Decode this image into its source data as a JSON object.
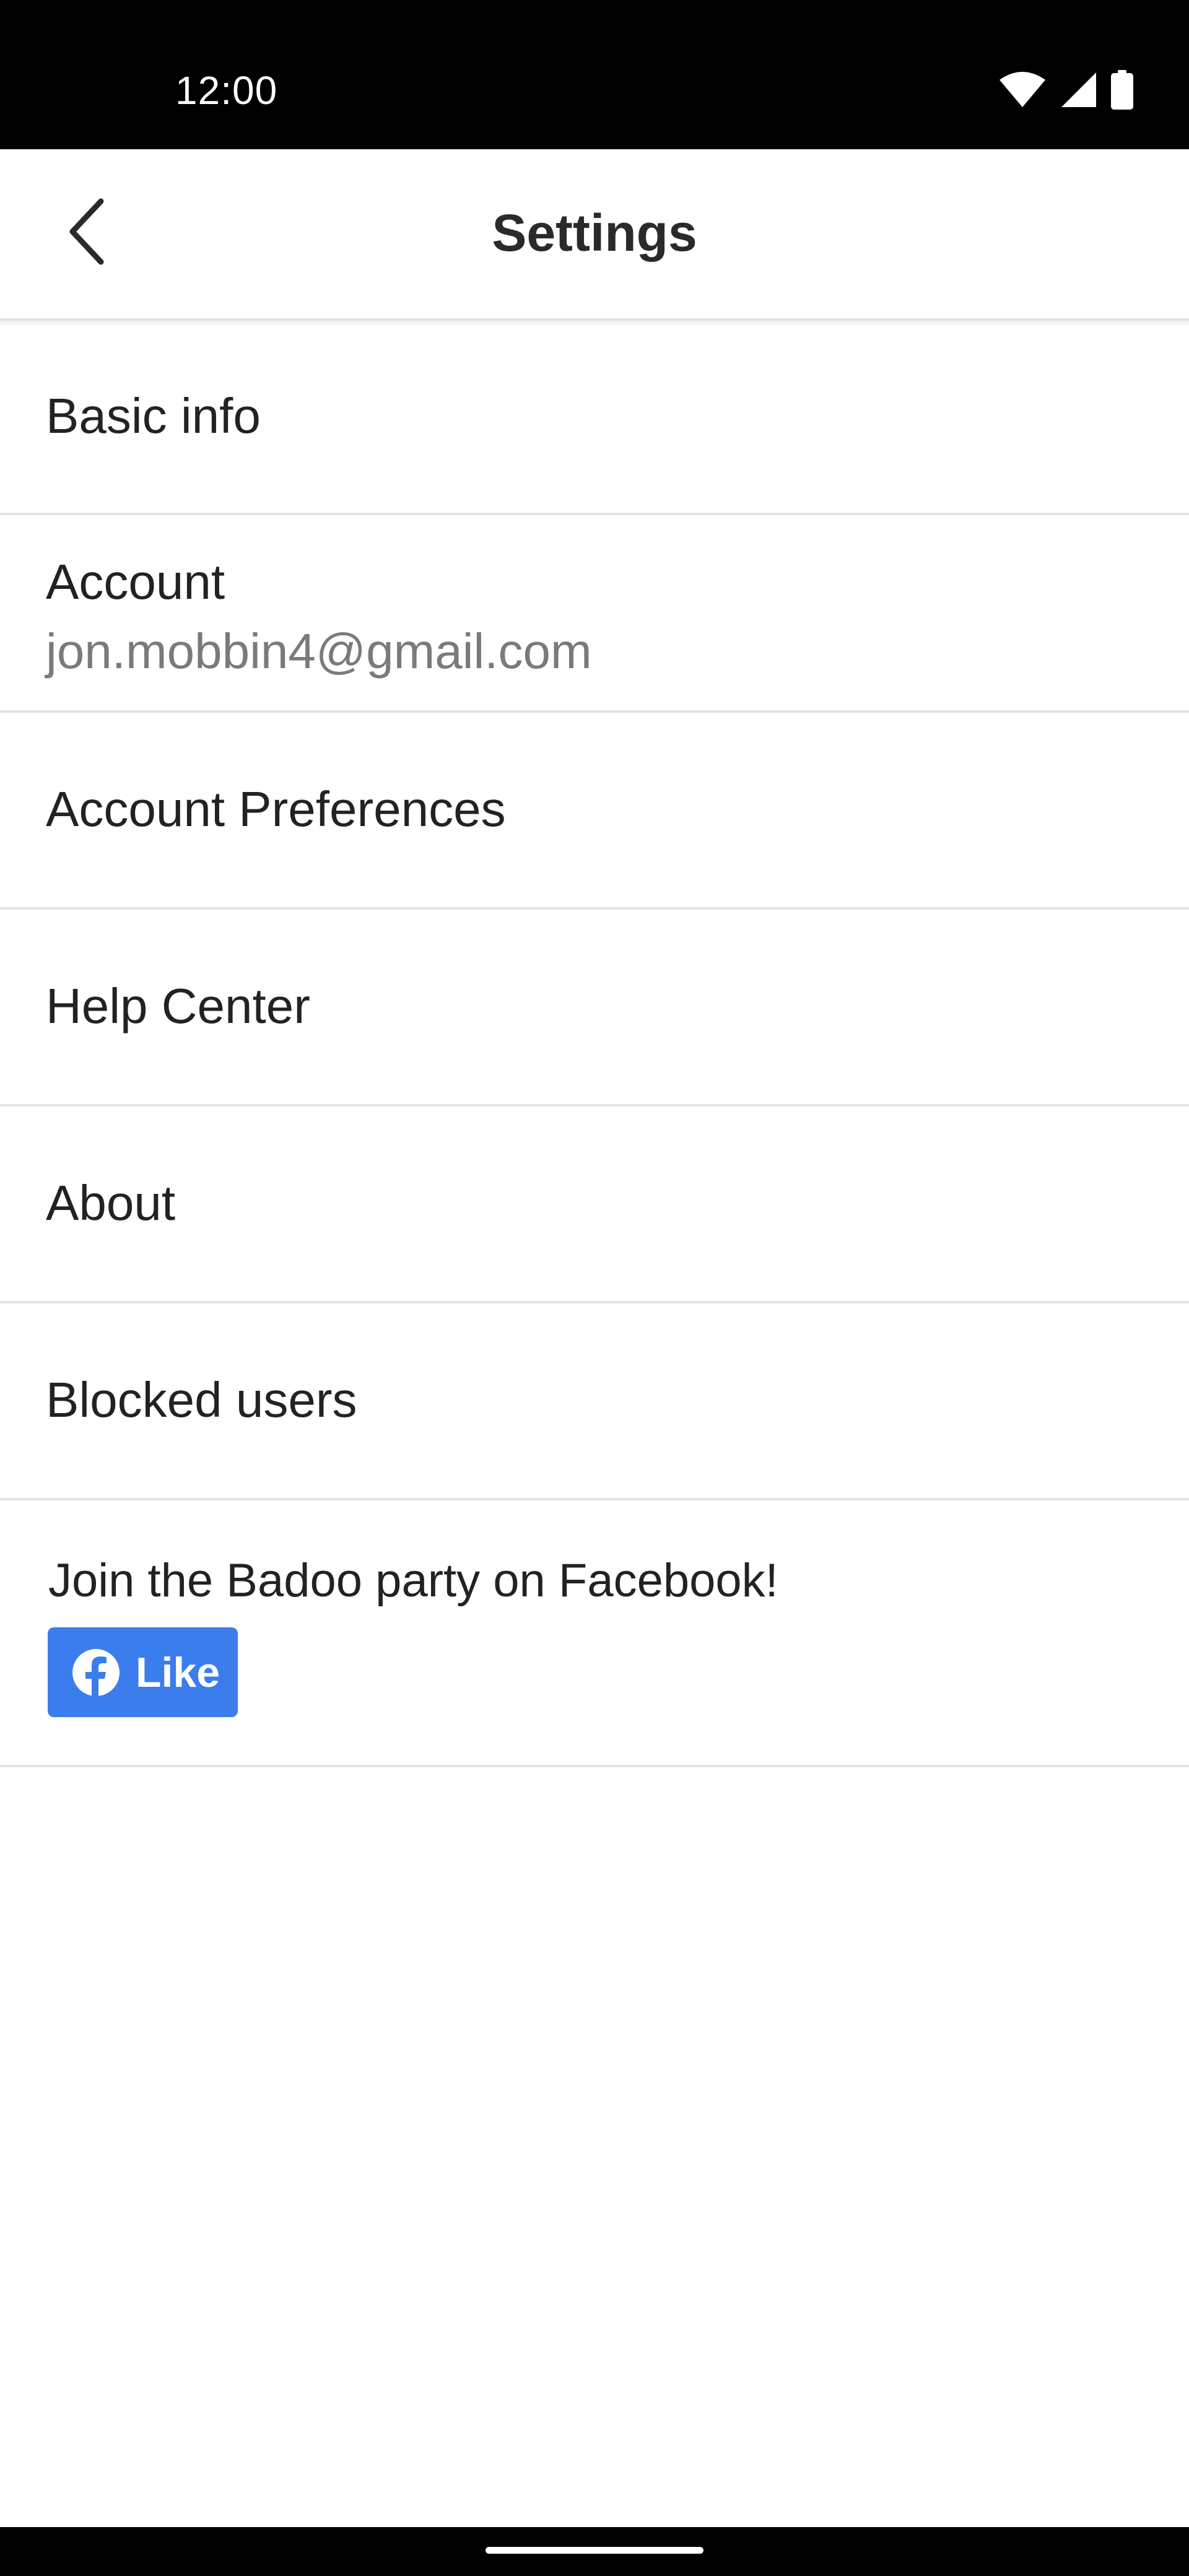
{
  "status_bar": {
    "time": "12:00",
    "icons": [
      "wifi-icon",
      "signal-icon",
      "battery-icon"
    ]
  },
  "header": {
    "back_icon": "chevron-left-icon",
    "title": "Settings"
  },
  "settings_items": [
    {
      "label": "Basic info"
    },
    {
      "label": "Account",
      "sublabel": "jon.mobbin4@gmail.com"
    },
    {
      "label": "Account Preferences"
    },
    {
      "label": "Help Center"
    },
    {
      "label": "About"
    },
    {
      "label": "Blocked users"
    }
  ],
  "facebook_promo": {
    "text": "Join the Badoo party on Facebook!",
    "like_label": "Like",
    "icon": "facebook-icon",
    "button_color": "#3b7ded"
  },
  "colors": {
    "status_bar_bg": "#000000",
    "divider": "#e4e4e4",
    "primary_text": "#222222",
    "secondary_text": "#7a7a7a"
  }
}
